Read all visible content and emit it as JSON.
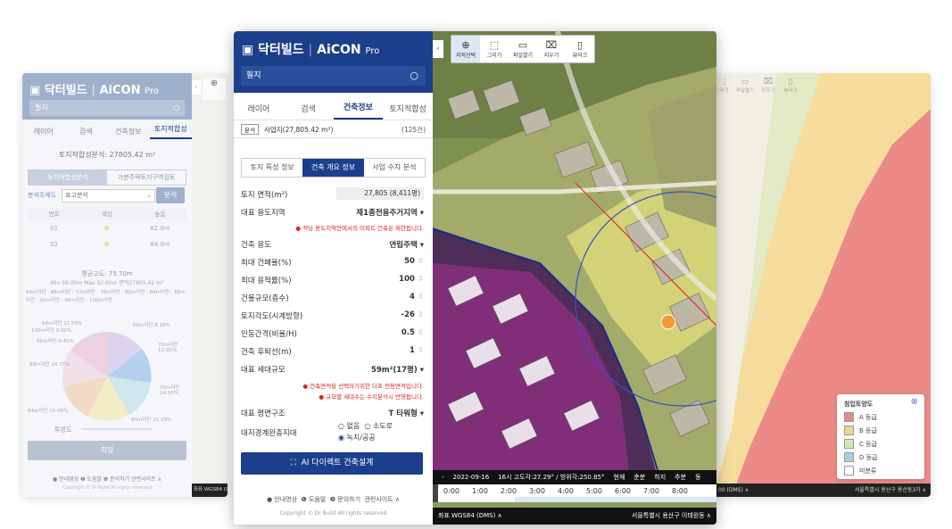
{
  "brand": {
    "name": "닥터빌드",
    "product": "AiCON",
    "suffix": "Pro"
  },
  "left_window": {
    "search_placeholder": "필지",
    "tabs": [
      "레이어",
      "검색",
      "건축정보",
      "토지적합성"
    ],
    "active_tab": 3,
    "area_label": "토지적합성분석: 27805.42 m²",
    "subtabs": [
      "토지적합성분석",
      "가분주택토지구역검토"
    ],
    "analysis_label": "분석주제도",
    "analysis_value": "표고분석",
    "analysis_button": "분석",
    "table_headers": [
      "번호",
      "색상",
      "높음"
    ],
    "table_rows": [
      [
        "01",
        "82.0m"
      ],
      [
        "02",
        "84.0m"
      ]
    ],
    "avg_label": "평균고도: 75.70m",
    "minmax": "Min 56.00m  Max 92.00m  면적27805.42 m²",
    "legend": [
      "64m미만",
      "68m미만",
      "72m미만",
      "76m미만",
      "80m미만",
      "84m미만",
      "88m미만",
      "92m미만",
      "96m미만",
      "100m미만"
    ],
    "pie_labels": [
      "64m미만 11.59%",
      "100m미만 0.00%",
      "96m미만 0.45%",
      "88m미만 14.77%",
      "84m미만 15.45%",
      "68m미만 8.18%",
      "72m미만 12.92%",
      "76m미만 14.55%",
      "80m미만 15.23%"
    ],
    "opacity_label": "투명도",
    "save_button": "저장",
    "footer": "● 안내영상  ❶ 도움말  ❷ 문의하기  관련사이트 ∧",
    "copyright": "Copyright © Dr Build All rights reserved",
    "coord": "좌표  WGS84 (DMS)"
  },
  "right_window": {
    "toolbar": [
      "그리기",
      "파일열기",
      "지우기",
      "뷰어크"
    ],
    "legend_title": "침입토양도",
    "legend_items": [
      {
        "label": "A 등급",
        "color": "#e88a84"
      },
      {
        "label": "B 등급",
        "color": "#f3d58e"
      },
      {
        "label": "C 등급",
        "color": "#d3e7b0"
      },
      {
        "label": "D 등급",
        "color": "#a9cfe6"
      },
      {
        "label": "미분류",
        "color": "#ffffff"
      }
    ],
    "coord": "00 (DMS) ∧",
    "address": "서울특별시 용산구 용산동3가 ∧"
  },
  "main_window": {
    "search_placeholder": "필지",
    "tabs": [
      "레이어",
      "검색",
      "건축정보",
      "토지적합성"
    ],
    "active_tab": 2,
    "badge": "분석",
    "site": "사업지(27,805.42 m²)",
    "count": "(125건)",
    "subtabs": [
      "토지 특성 정보",
      "건축 개요 정보",
      "사업 수지 분석"
    ],
    "active_subtab": 1,
    "land_area_label": "토지 면적(m²)",
    "land_area_value": "27,805 (8,411평)",
    "zone_label": "대표 용도지역",
    "zone_value": "제1종전용주거지역 ▾",
    "zone_note": "● 적당 용도지역안에서의 이파트 건축은 제한됩니다.",
    "fields": [
      {
        "label": "건축 용도",
        "value": "연립주택 ▾"
      },
      {
        "label": "최대 건폐율(%)",
        "value": "50"
      },
      {
        "label": "최대 용적률(%)",
        "value": "100"
      },
      {
        "label": "건물규모(층수)",
        "value": "4"
      },
      {
        "label": "토지각도(시계방향)",
        "value": "-26"
      },
      {
        "label": "인동간격(비율/H)",
        "value": "0.5"
      },
      {
        "label": "건축 후퇴선(m)",
        "value": "1"
      },
      {
        "label": "대표 세대규모",
        "value": "59m²(17평) ▾"
      }
    ],
    "notes": [
      "● 건축면적을 선택하기위한 더표 전용면적입니다.",
      "● 규모별 세대수는 수지분석시 반영됩니다."
    ],
    "plan_label": "대표 평면구조",
    "plan_value": "T 타워형 ▾",
    "buffer_label": "대지경계완충지대",
    "radio": [
      "없음",
      "소도로",
      "녹지/공공"
    ],
    "radio_selected": 2,
    "ai_button": "AI 다이렉트 건축설계",
    "footer": [
      "● 안내영상",
      "❶ 도움말",
      "❷ 문의하기",
      "관련사이트 ∧"
    ],
    "copyright": "Copyright © Dr Build All rights reserved",
    "toolbar": [
      "지적선택",
      "그리기",
      "파일열기",
      "지우기",
      "뷰어크"
    ],
    "time_bar": [
      "-",
      "2022-09-16",
      "16시 고도각:27.29° / 방위각:250.85°",
      "현재",
      "춘분",
      "하지",
      "추분",
      "동"
    ],
    "ticks": [
      "0:00",
      "1:00",
      "2:00",
      "3:00",
      "4:00",
      "5:00",
      "6:00",
      "7:00",
      "8:00"
    ],
    "coord": "좌표  WGS84 (DMS) ∧",
    "address": "서울특별시 용산구 이태원동 ∧"
  }
}
